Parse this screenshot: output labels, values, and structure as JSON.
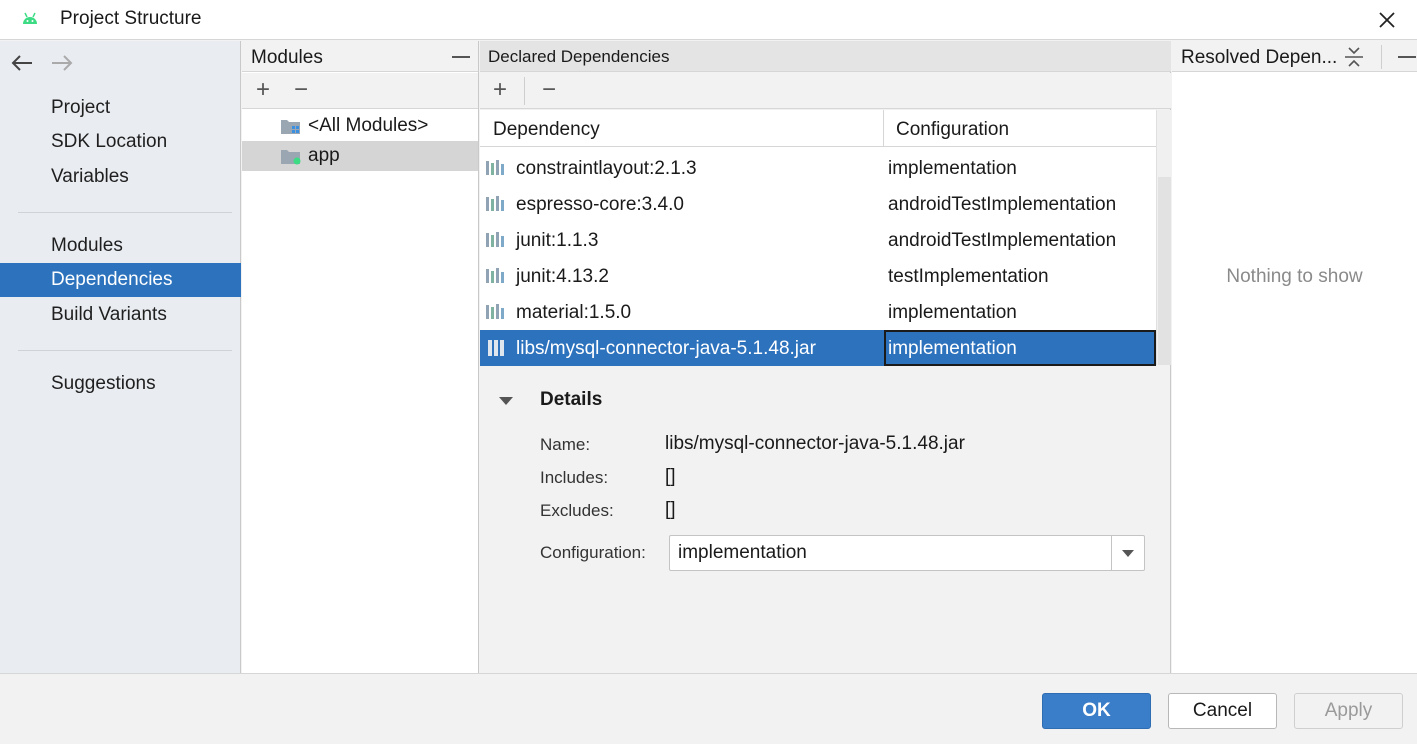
{
  "window": {
    "title": "Project Structure"
  },
  "sidebar": {
    "items": [
      {
        "label": "Project"
      },
      {
        "label": "SDK Location"
      },
      {
        "label": "Variables"
      },
      {
        "label": "Modules"
      },
      {
        "label": "Dependencies",
        "selected": true
      },
      {
        "label": "Build Variants"
      },
      {
        "label": "Suggestions"
      }
    ]
  },
  "modules": {
    "title": "Modules",
    "items": [
      {
        "label": "<All Modules>"
      },
      {
        "label": "app",
        "selected": true
      }
    ]
  },
  "declared": {
    "title": "Declared Dependencies",
    "columns": [
      "Dependency",
      "Configuration"
    ],
    "rows": [
      {
        "dependency": "constraintlayout:2.1.3",
        "configuration": "implementation"
      },
      {
        "dependency": "espresso-core:3.4.0",
        "configuration": "androidTestImplementation"
      },
      {
        "dependency": "junit:1.1.3",
        "configuration": "androidTestImplementation"
      },
      {
        "dependency": "junit:4.13.2",
        "configuration": "testImplementation"
      },
      {
        "dependency": "material:1.5.0",
        "configuration": "implementation"
      },
      {
        "dependency": "libs/mysql-connector-java-5.1.48.jar",
        "configuration": "implementation",
        "selected": true
      }
    ]
  },
  "details": {
    "title": "Details",
    "name_label": "Name:",
    "name_value": "libs/mysql-connector-java-5.1.48.jar",
    "includes_label": "Includes:",
    "includes_value": "[]",
    "excludes_label": "Excludes:",
    "excludes_value": "[]",
    "configuration_label": "Configuration:",
    "configuration_value": "implementation"
  },
  "resolved": {
    "title": "Resolved Depen...",
    "empty_text": "Nothing to show"
  },
  "footer": {
    "ok": "OK",
    "cancel": "Cancel",
    "apply": "Apply"
  },
  "colors": {
    "accent": "#2d72bd",
    "android_green": "#3ddc84"
  }
}
